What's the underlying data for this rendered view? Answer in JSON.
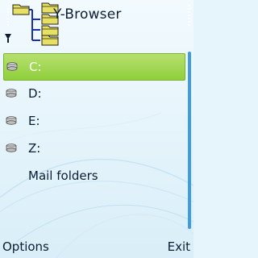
{
  "app": {
    "title": "Y-Browser"
  },
  "list": {
    "items": [
      {
        "label": "C:",
        "icon": "drive-icon",
        "selected": true
      },
      {
        "label": "D:",
        "icon": "drive-icon",
        "selected": false
      },
      {
        "label": "E:",
        "icon": "drive-icon",
        "selected": false
      },
      {
        "label": "Z:",
        "icon": "drive-icon",
        "selected": false
      },
      {
        "label": "Mail folders",
        "icon": "",
        "selected": false
      }
    ]
  },
  "softkeys": {
    "left": "Options",
    "right": "Exit"
  },
  "colors": {
    "selection": "#a6d954",
    "scroll_thumb": "#3f9cde",
    "background": "#e6f4fb"
  }
}
